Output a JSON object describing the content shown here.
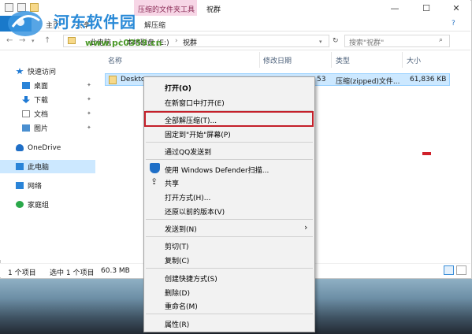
{
  "window": {
    "tool_tab": "压缩的文件夹工具",
    "title": "祝群",
    "quick_access_icons": [
      "folder-icon",
      "undo-icon",
      "new-folder-icon"
    ],
    "buttons": {
      "minimize": "—",
      "maximize": "☐",
      "close": "✕",
      "help": "?"
    }
  },
  "ribbon": {
    "file_tab": "",
    "tabs": [
      "主页",
      "共享",
      "解压缩"
    ]
  },
  "address": {
    "crumbs": [
      "此电脑",
      "本地磁盘 (E:)",
      "祝群"
    ],
    "search_placeholder": "搜索\"祝群\""
  },
  "nav": {
    "items": [
      {
        "label": "快速访问",
        "icon": "star-icon",
        "color": "#1f7ad4"
      },
      {
        "label": "桌面",
        "icon": "desktop-icon",
        "color": "#2a84d8",
        "pinned": true
      },
      {
        "label": "下载",
        "icon": "download-icon",
        "color": "#1f7ad4",
        "pinned": true
      },
      {
        "label": "文档",
        "icon": "document-icon",
        "color": "#8a8a8a",
        "pinned": true
      },
      {
        "label": "图片",
        "icon": "picture-icon",
        "color": "#4a8fd0",
        "pinned": true
      },
      {
        "label": "OneDrive",
        "icon": "cloud-icon",
        "color": "#1f6fc7"
      },
      {
        "label": "此电脑",
        "icon": "computer-icon",
        "color": "#2a84d8",
        "selected": true
      },
      {
        "label": "网络",
        "icon": "network-icon",
        "color": "#2a84d8"
      },
      {
        "label": "家庭组",
        "icon": "homegroup-icon",
        "color": "#2aa84a"
      }
    ]
  },
  "columns": [
    "名称",
    "修改日期",
    "类型",
    "大小"
  ],
  "file": {
    "name": "Deskto",
    "date": "53",
    "type": "压缩(zipped)文件...",
    "size": "61,836 KB"
  },
  "status": {
    "count": "1 个项目",
    "selected": "选中 1 个项目",
    "size": "60.3 MB"
  },
  "context_menu": {
    "items": [
      {
        "label": "打开(O)",
        "bold": true
      },
      {
        "label": "在新窗口中打开(E)"
      },
      {
        "label": "全部解压缩(T)...",
        "highlighted": true
      },
      {
        "label": "固定到\"开始\"屏幕(P)"
      },
      {
        "label": "通过QQ发送到"
      },
      {
        "label": "使用 Windows Defender扫描...",
        "icon": "defender-icon"
      },
      {
        "label": "共享",
        "icon": "share-icon"
      },
      {
        "label": "打开方式(H)..."
      },
      {
        "label": "还原以前的版本(V)"
      },
      {
        "label": "发送到(N)",
        "submenu": "›"
      },
      {
        "label": "剪切(T)"
      },
      {
        "label": "复制(C)"
      },
      {
        "label": "创建快捷方式(S)"
      },
      {
        "label": "删除(D)"
      },
      {
        "label": "重命名(M)"
      },
      {
        "label": "属性(R)"
      }
    ]
  },
  "watermark": {
    "title": "河东软件园",
    "url": "www.pc0359.cn"
  }
}
